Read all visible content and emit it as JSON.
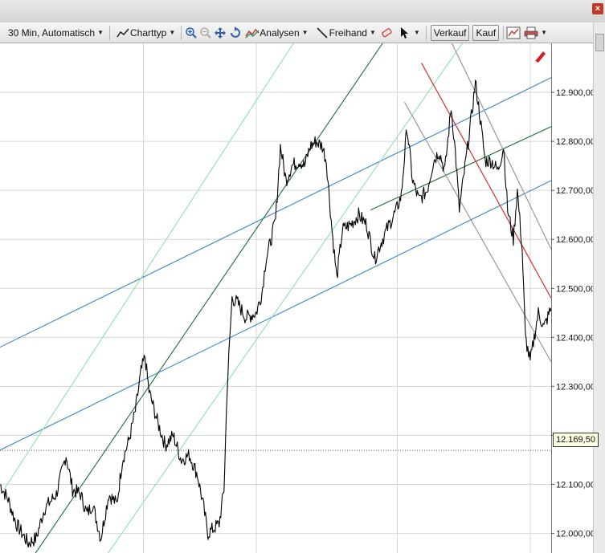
{
  "toolbar": {
    "interval_label": "30 Min,  Automatisch",
    "charttype_label": "Charttyp",
    "analysen_label": "Analysen",
    "freihand_label": "Freihand",
    "verkauf_label": "Verkauf",
    "kauf_label": "Kauf",
    "icons": [
      "line-chart-icon",
      "zoom-in-icon",
      "zoom-out-icon",
      "move-icon",
      "undo-icon",
      "analysis-icon",
      "pen-line-icon",
      "eraser-icon",
      "cursor-icon",
      "chart-settings-icon",
      "print-icon"
    ]
  },
  "colors": {
    "price": "#000000",
    "blue_channel": "#3a86c8",
    "green_trend": "#1e6e3a",
    "light_green": "#8ee0b4",
    "red_trend": "#d42020",
    "gray_channel": "#909090",
    "grid": "#d6d6d6"
  },
  "chart_data": {
    "type": "line",
    "series_color": "#000000",
    "y_axis_position": "right",
    "ylim": [
      11960,
      13000
    ],
    "y_ticks": [
      12000,
      12100,
      12200,
      12300,
      12400,
      12500,
      12600,
      12700,
      12800,
      12900
    ],
    "y_tick_labels": [
      "12.000,00",
      "12.100,00",
      "12.200,00",
      "12.300,00",
      "12.400,00",
      "12.500,00",
      "12.600,00",
      "12.700,00",
      "12.800,00",
      "12.900,00"
    ],
    "current_price": 12169.5,
    "current_price_label": "12.169,50",
    "grid": true,
    "x_index_range": [
      0,
      684
    ],
    "x_gridlines": [
      178,
      318,
      493,
      658
    ],
    "price_keypoints": [
      [
        0,
        12100
      ],
      [
        10,
        12070
      ],
      [
        20,
        12020
      ],
      [
        35,
        11980
      ],
      [
        45,
        11990
      ],
      [
        55,
        12050
      ],
      [
        70,
        12080
      ],
      [
        82,
        12160
      ],
      [
        90,
        12090
      ],
      [
        100,
        12080
      ],
      [
        108,
        12040
      ],
      [
        115,
        12060
      ],
      [
        125,
        11990
      ],
      [
        135,
        12080
      ],
      [
        145,
        12060
      ],
      [
        152,
        12150
      ],
      [
        160,
        12190
      ],
      [
        168,
        12250
      ],
      [
        175,
        12330
      ],
      [
        180,
        12360
      ],
      [
        185,
        12290
      ],
      [
        195,
        12230
      ],
      [
        205,
        12180
      ],
      [
        215,
        12200
      ],
      [
        225,
        12150
      ],
      [
        235,
        12160
      ],
      [
        245,
        12120
      ],
      [
        252,
        12060
      ],
      [
        258,
        12000
      ],
      [
        265,
        12010
      ],
      [
        272,
        12020
      ],
      [
        278,
        12090
      ],
      [
        282,
        12300
      ],
      [
        288,
        12480
      ],
      [
        295,
        12470
      ],
      [
        305,
        12440
      ],
      [
        318,
        12450
      ],
      [
        325,
        12490
      ],
      [
        330,
        12560
      ],
      [
        335,
        12590
      ],
      [
        342,
        12640
      ],
      [
        348,
        12790
      ],
      [
        355,
        12720
      ],
      [
        362,
        12750
      ],
      [
        372,
        12760
      ],
      [
        378,
        12750
      ],
      [
        385,
        12790
      ],
      [
        392,
        12800
      ],
      [
        400,
        12790
      ],
      [
        405,
        12760
      ],
      [
        412,
        12620
      ],
      [
        418,
        12520
      ],
      [
        425,
        12620
      ],
      [
        435,
        12630
      ],
      [
        445,
        12650
      ],
      [
        455,
        12630
      ],
      [
        465,
        12560
      ],
      [
        472,
        12590
      ],
      [
        480,
        12620
      ],
      [
        492,
        12660
      ],
      [
        498,
        12690
      ],
      [
        505,
        12830
      ],
      [
        512,
        12720
      ],
      [
        520,
        12680
      ],
      [
        530,
        12700
      ],
      [
        538,
        12760
      ],
      [
        545,
        12780
      ],
      [
        552,
        12740
      ],
      [
        560,
        12870
      ],
      [
        565,
        12780
      ],
      [
        570,
        12660
      ],
      [
        578,
        12760
      ],
      [
        585,
        12850
      ],
      [
        590,
        12920
      ],
      [
        595,
        12860
      ],
      [
        602,
        12760
      ],
      [
        610,
        12760
      ],
      [
        618,
        12740
      ],
      [
        625,
        12790
      ],
      [
        630,
        12660
      ],
      [
        637,
        12600
      ],
      [
        642,
        12700
      ],
      [
        648,
        12580
      ],
      [
        652,
        12400
      ],
      [
        658,
        12350
      ],
      [
        662,
        12390
      ],
      [
        668,
        12450
      ],
      [
        675,
        12420
      ],
      [
        684,
        12460
      ]
    ],
    "trend_lines": [
      {
        "style": "blue_channel",
        "p1": [
          0,
          12380
        ],
        "p2": [
          684,
          12930
        ]
      },
      {
        "style": "blue_channel",
        "p1": [
          0,
          12170
        ],
        "p2": [
          684,
          12720
        ]
      },
      {
        "style": "green_trend",
        "p1": [
          40,
          11950
        ],
        "p2": [
          483,
          13020
        ]
      },
      {
        "style": "green_trend",
        "p1": [
          460,
          12660
        ],
        "p2": [
          684,
          12830
        ]
      },
      {
        "style": "light_green",
        "p1": [
          5,
          12090
        ],
        "p2": [
          372,
          13020
        ]
      },
      {
        "style": "light_green",
        "p1": [
          130,
          11950
        ],
        "p2": [
          582,
          13020
        ]
      },
      {
        "style": "red_trend",
        "p1": [
          523,
          12960
        ],
        "p2": [
          684,
          12480
        ]
      },
      {
        "style": "gray_channel",
        "p1": [
          502,
          12880
        ],
        "p2": [
          684,
          12350
        ]
      },
      {
        "style": "gray_channel",
        "p1": [
          555,
          13020
        ],
        "p2": [
          684,
          12580
        ]
      }
    ]
  }
}
